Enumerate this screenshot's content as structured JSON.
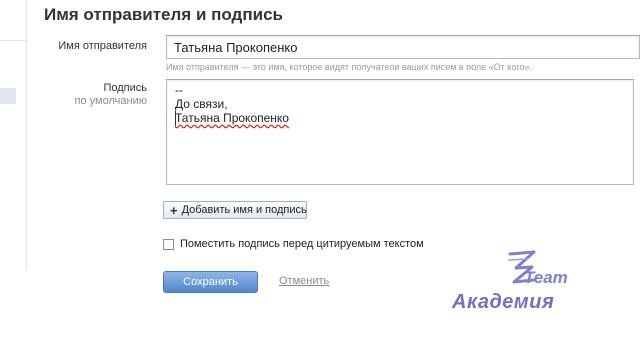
{
  "section": {
    "title": "Имя отправителя и подпись"
  },
  "sender": {
    "label": "Имя отправителя",
    "value": "Татьяна Прокопенко",
    "hint": "Имя отправителя — это имя, которое видят получатели ваших писем в поле «От кого»."
  },
  "signature": {
    "label": "Подпись",
    "sublabel": "по умолчанию",
    "lines": [
      "--",
      "До связи,",
      "Татьяна Прокопенко"
    ]
  },
  "actions": {
    "add_label": "Добавить имя и подпись",
    "add_icon": "plus-icon",
    "checkbox_label": "Поместить подпись перед цитируемым текстом",
    "checkbox_checked": false,
    "save_label": "Сохранить",
    "cancel_label": "Отменить"
  },
  "watermark": {
    "line1": "Team",
    "line2": "Академия"
  },
  "colors": {
    "save_button": "#4f86cf",
    "watermark": "#7f82c8"
  }
}
